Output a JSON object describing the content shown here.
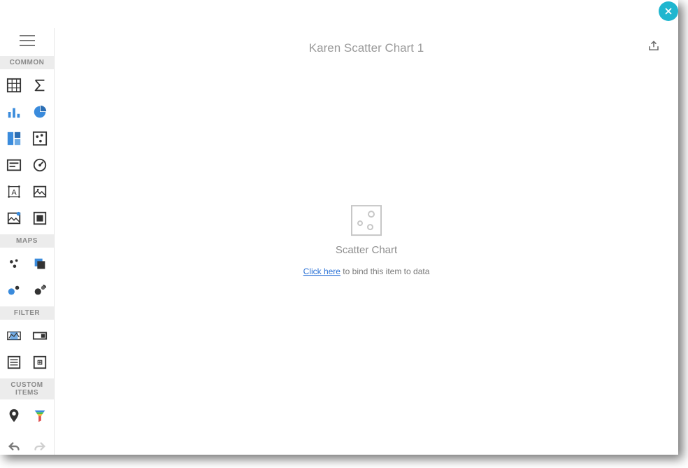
{
  "close": {
    "tooltip": "Close"
  },
  "header": {
    "title": "Karen Scatter Chart 1"
  },
  "sidebar": {
    "sections": {
      "common": "COMMON",
      "maps": "MAPS",
      "filter": "FILTER",
      "custom": "CUSTOM ITEMS"
    }
  },
  "emptyState": {
    "title": "Scatter Chart",
    "link": "Click here",
    "hintTail": " to bind this item to data"
  }
}
